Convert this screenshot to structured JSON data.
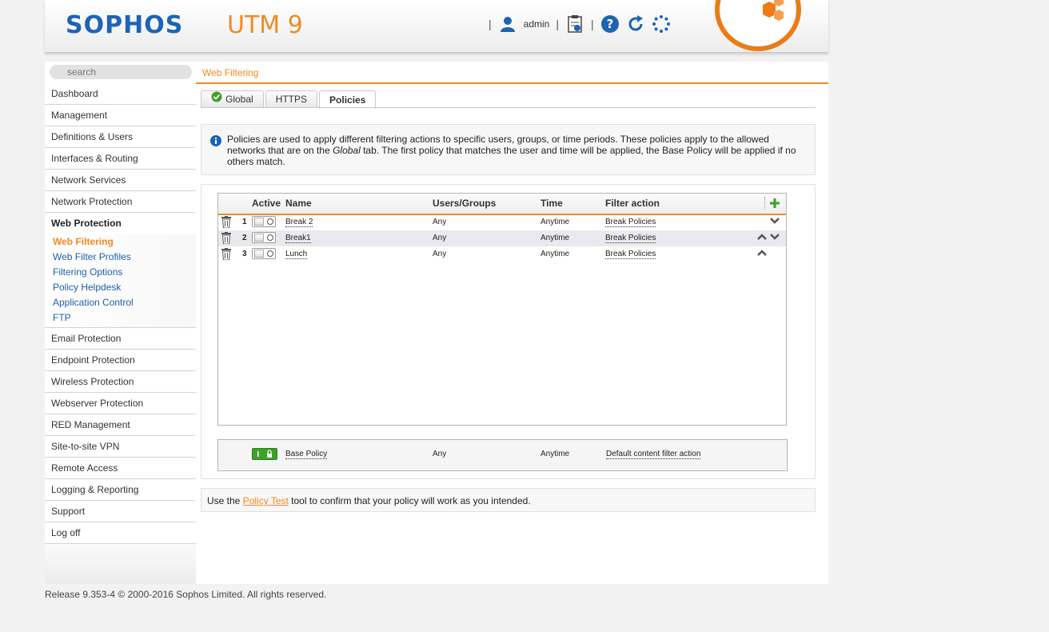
{
  "header": {
    "brand": "SOPHOS",
    "product": "UTM 9",
    "user": "admin",
    "separator": "|"
  },
  "search": {
    "placeholder": "search"
  },
  "sidebar": {
    "items_before": [
      "Dashboard",
      "Management",
      "Definitions & Users",
      "Interfaces & Routing",
      "Network Services",
      "Network Protection"
    ],
    "active": "Web Protection",
    "subitems": [
      "Web Filtering",
      "Web Filter Profiles",
      "Filtering Options",
      "Policy Helpdesk",
      "Application Control",
      "FTP"
    ],
    "items_after": [
      "Email Protection",
      "Endpoint Protection",
      "Wireless Protection",
      "Webserver Protection",
      "RED Management",
      "Site-to-site VPN",
      "Remote Access",
      "Logging & Reporting",
      "Support",
      "Log off"
    ]
  },
  "main": {
    "breadcrumb": "Web Filtering",
    "tabs": [
      "Global",
      "HTTPS",
      "Policies"
    ],
    "info": {
      "part1": "Policies are used to apply different filtering actions to specific users, groups, or time periods. These policies apply to the allowed networks that are on the ",
      "em": "Global",
      "part2": " tab. The first policy that matches the user and time will be applied, the Base Policy will be applied if no others match."
    },
    "table": {
      "headers": [
        "Active",
        "Name",
        "Users/Groups",
        "Time",
        "Filter action"
      ],
      "rows": [
        {
          "num": "1",
          "name": "Break 2",
          "users": "Any",
          "time": "Anytime",
          "action": "Break Policies"
        },
        {
          "num": "2",
          "name": "Break1",
          "users": "Any",
          "time": "Anytime",
          "action": "Break Policies"
        },
        {
          "num": "3",
          "name": "Lunch",
          "users": "Any",
          "time": "Anytime",
          "action": "Break Policies"
        }
      ]
    },
    "base_policy": {
      "name": "Base Policy",
      "users": "Any",
      "time": "Anytime",
      "action": "Default content filter action"
    },
    "tip": {
      "before": "Use the ",
      "link": "Policy Test",
      "after": " tool to confirm that your policy will work as you intended."
    }
  },
  "footer": "Release 9.353-4  © 2000-2016 Sophos Limited. All rights reserved.",
  "colors": {
    "accent": "#f08a24",
    "brand": "#1c64b4",
    "link": "#1e5faa",
    "success": "#3ea02a"
  }
}
